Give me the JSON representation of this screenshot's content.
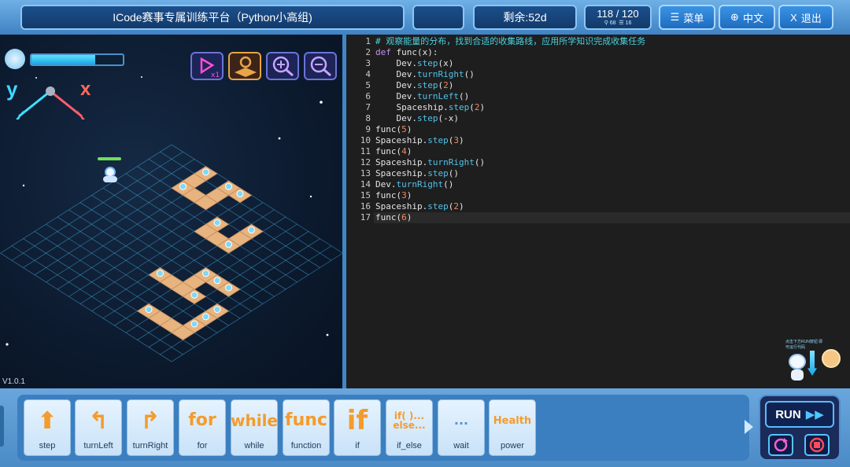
{
  "header": {
    "title": "ICode赛事专属训练平台（Python小高组)",
    "blank": "",
    "remaining": "剩余:52d",
    "progress_main": "118 / 120",
    "progress_sub1": "68",
    "progress_sub2": "16",
    "menu_label": "菜单",
    "lang_label": "中文",
    "exit_label": "退出"
  },
  "scene": {
    "energy_level": 0.7,
    "axis_y": "y",
    "axis_x": "x",
    "version": "V1.0.1",
    "tools": [
      "speed-x1-icon",
      "map-icon",
      "zoom-in-icon",
      "zoom-out-icon"
    ]
  },
  "editor": {
    "lines": [
      "# 观察能量的分布，找到合适的收集路线，应用所学知识完成收集任务",
      "def func(x):",
      "    Dev.step(x)",
      "    Dev.turnRight()",
      "    Dev.step(2)",
      "    Dev.turnLeft()",
      "    Spaceship.step(2)",
      "    Dev.step(-x)",
      "func(5)",
      "Spaceship.step(3)",
      "func(4)",
      "Spaceship.turnRight()",
      "Spaceship.step()",
      "Dev.turnRight()",
      "func(3)",
      "Spaceship.step(2)",
      "func(6)"
    ],
    "line_numbers": [
      "1",
      "2",
      "3",
      "4",
      "5",
      "6",
      "7",
      "8",
      "9",
      "10",
      "11",
      "12",
      "13",
      "14",
      "15",
      "16",
      "17"
    ]
  },
  "blocks": [
    {
      "label": "step",
      "icon_text": ""
    },
    {
      "label": "turnLeft",
      "icon_text": ""
    },
    {
      "label": "turnRight",
      "icon_text": ""
    },
    {
      "label": "for",
      "icon_text": "for"
    },
    {
      "label": "while",
      "icon_text": "while"
    },
    {
      "label": "function",
      "icon_text": "func"
    },
    {
      "label": "if",
      "icon_text": "if"
    },
    {
      "label": "if_else",
      "icon_text": "if( )...\nelse..."
    },
    {
      "label": "wait",
      "icon_text": "..."
    },
    {
      "label": "power",
      "icon_text": "Health"
    }
  ],
  "run": {
    "run_label": "RUN",
    "hint": "点击下方RUN按钮 即可运行代码"
  },
  "colors": {
    "accent": "#3f82c3",
    "editor_bg": "#1e1e1e",
    "block_orange": "#f59b2b",
    "energy": "#2fc2f0"
  }
}
